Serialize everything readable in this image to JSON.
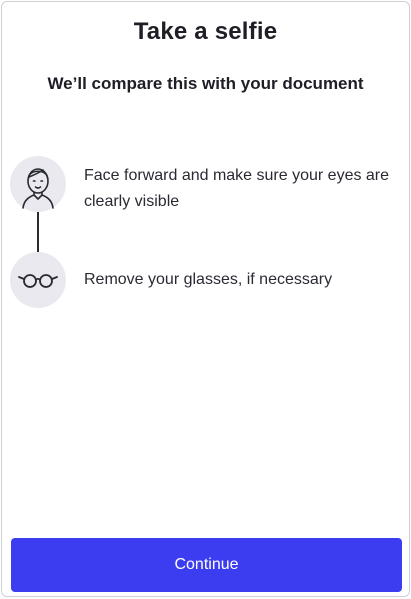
{
  "header": {
    "title": "Take a selfie",
    "subtitle": "We’ll compare this with your document"
  },
  "steps": [
    {
      "icon": "face-icon",
      "text": "Face forward and make sure your eyes are clearly visible"
    },
    {
      "icon": "glasses-icon",
      "text": "Remove your glasses, if necessary"
    }
  ],
  "actions": {
    "continue_label": "Continue"
  },
  "colors": {
    "primary": "#3c3cf0",
    "icon_background": "#e9e9ef",
    "text": "#1e1e26"
  }
}
